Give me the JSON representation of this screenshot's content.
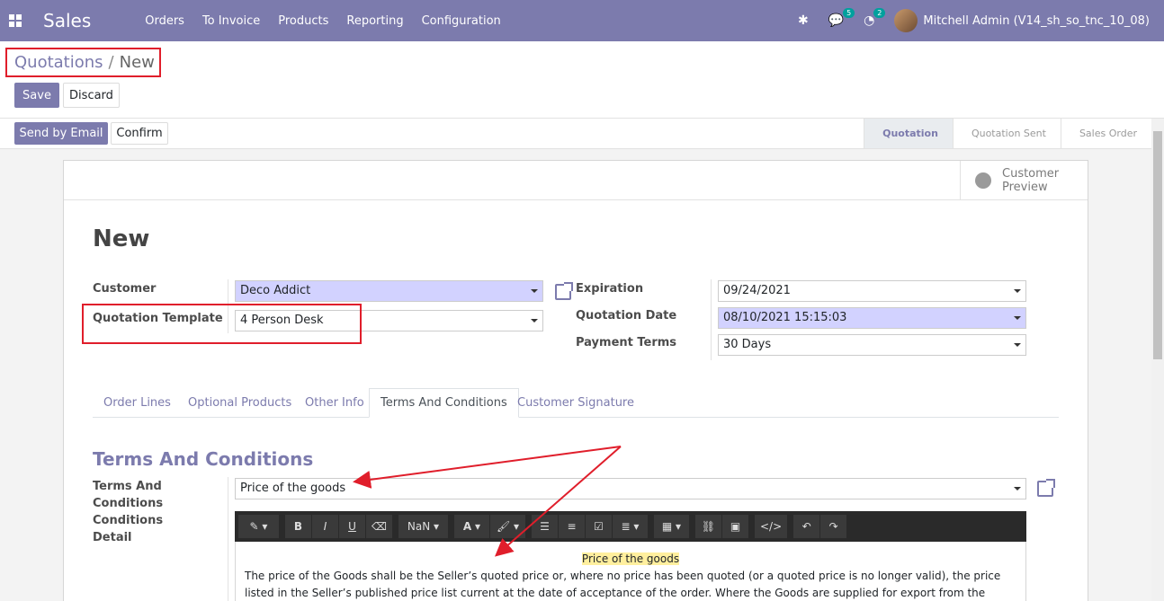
{
  "app": {
    "brand": "Sales"
  },
  "menu": [
    "Orders",
    "To Invoice",
    "Products",
    "Reporting",
    "Configuration"
  ],
  "nav": {
    "messages_count": "5",
    "activities_count": "2",
    "user_name": "Mitchell Admin (V14_sh_so_tnc_10_08)"
  },
  "breadcrumb": {
    "parent": "Quotations",
    "separator": "/",
    "current": "New"
  },
  "buttons": {
    "save": "Save",
    "discard": "Discard",
    "send_email": "Send by Email",
    "confirm": "Confirm"
  },
  "stages": [
    "Quotation",
    "Quotation Sent",
    "Sales Order"
  ],
  "customer_preview": "Customer Preview",
  "record": {
    "title": "New",
    "customer_label": "Customer",
    "customer_value": "Deco Addict",
    "template_label": "Quotation Template",
    "template_value": "4 Person Desk",
    "expiration_label": "Expiration",
    "expiration_value": "09/24/2021",
    "quotation_date_label": "Quotation Date",
    "quotation_date_value": "08/10/2021 15:15:03",
    "payment_terms_label": "Payment Terms",
    "payment_terms_value": "30 Days"
  },
  "tabs": [
    "Order Lines",
    "Optional Products",
    "Other Info",
    "Terms And Conditions",
    "Customer Signature"
  ],
  "terms": {
    "section_title": "Terms And Conditions",
    "field_label": "Terms And Conditions Conditions Detail",
    "field_value": "Price of the goods",
    "toolbar": {
      "font_size": "NaN"
    },
    "editor_heading": "Price of the goods",
    "editor_text": "The price of the Goods shall be the Seller’s quoted price or, where no price has been quoted (or a quoted price is no longer valid), the price listed in the Seller’s published price list current at the date of acceptance of the order. Where the Goods are supplied for export from the United Kingdom, the Seller’s published export"
  },
  "colors": {
    "brand": "#7c7bad",
    "highlight": "#e01e2b",
    "required": "#d2d2ff"
  }
}
